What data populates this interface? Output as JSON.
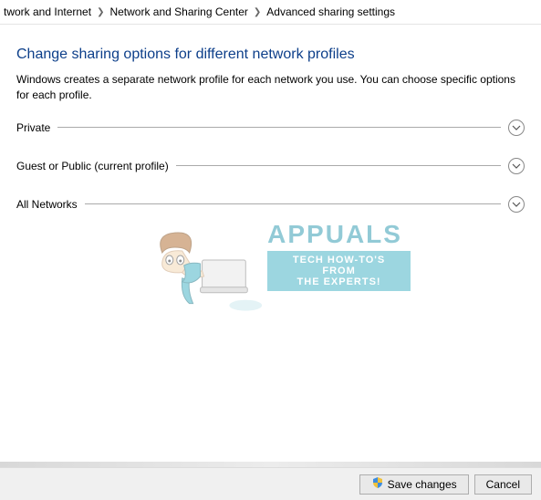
{
  "breadcrumb": {
    "item0": "twork and Internet",
    "item1": "Network and Sharing Center",
    "item2": "Advanced sharing settings"
  },
  "heading": "Change sharing options for different network profiles",
  "description": "Windows creates a separate network profile for each network you use. You can choose specific options for each profile.",
  "sections": {
    "private": "Private",
    "guest": "Guest or Public (current profile)",
    "all": "All Networks"
  },
  "watermark": {
    "brand": "APPUALS",
    "tagline1": "TECH HOW-TO'S FROM",
    "tagline2": "THE EXPERTS!"
  },
  "buttons": {
    "save": "Save changes",
    "cancel": "Cancel"
  },
  "colors": {
    "title": "#0d3f8a",
    "watermark": "#4db6c8"
  }
}
